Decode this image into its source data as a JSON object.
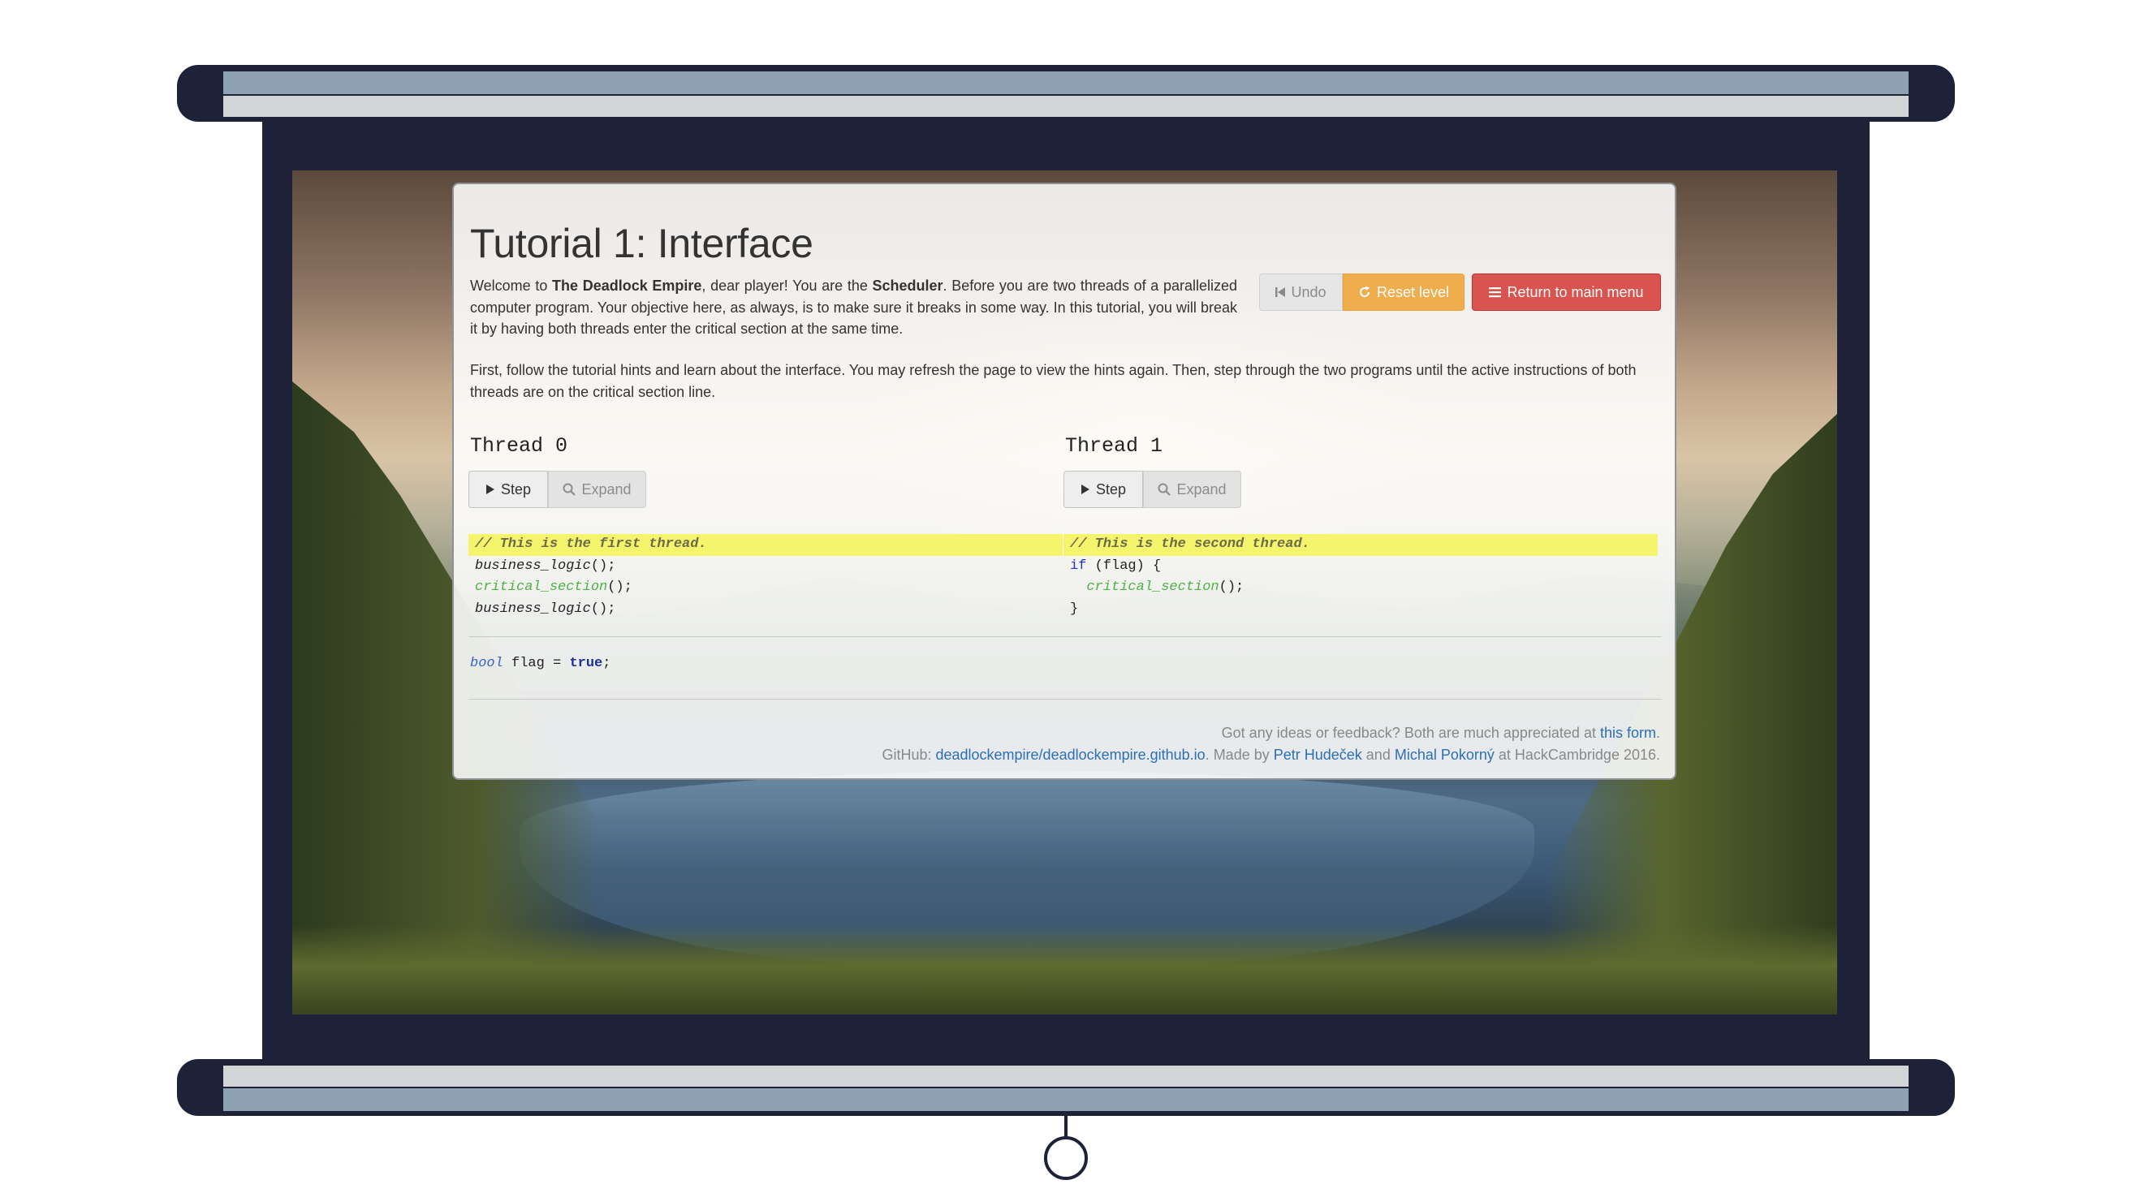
{
  "page": {
    "title": "Tutorial 1: Interface",
    "intro": {
      "p1": "Welcome to ",
      "b1": "The Deadlock Empire",
      "p2": ", dear player! You are the ",
      "b2": "Scheduler",
      "p3": ". Before you are two threads of a parallelized computer program. Your objective here, as always, is to make sure it breaks in some way. In this tutorial, you will break it by having both threads enter the critical section at the same time."
    },
    "instructions": "First, follow the tutorial hints and learn about the interface. You may refresh the page to view the hints again. Then, step through the two programs until the active instructions of both threads are on the critical section line."
  },
  "toolbar": {
    "undo_label": "Undo",
    "reset_label": "Reset level",
    "menu_label": "Return to main menu"
  },
  "threads": [
    {
      "title": "Thread 0",
      "step_label": "Step",
      "expand_label": "Expand",
      "lines": {
        "l0": "// This is the first thread.",
        "l1_fn": "business_logic",
        "l1_rest": "();",
        "l2_fn": "critical_section",
        "l2_rest": "();",
        "l3_fn": "business_logic",
        "l3_rest": "();"
      }
    },
    {
      "title": "Thread 1",
      "step_label": "Step",
      "expand_label": "Expand",
      "lines": {
        "l0": "// This is the second thread.",
        "l1_kw": "if",
        "l1_rest": " (flag) {",
        "l2_indent": "  ",
        "l2_fn": "critical_section",
        "l2_rest": "();",
        "l3": "}"
      }
    }
  ],
  "globals": {
    "type": "bool",
    "name": " flag = ",
    "value": "true",
    "end": ";"
  },
  "footer": {
    "feedback_text": "Got any ideas or feedback? Both are much appreciated at ",
    "feedback_link": "this form",
    "feedback_end": ".",
    "github_prefix": "GitHub: ",
    "github_link": "deadlockempire/deadlockempire.github.io",
    "made_by": ". Made by ",
    "author1": "Petr Hudeček",
    "and": " and ",
    "author2": "Michal Pokorný",
    "at": " at HackCambridge 2016."
  },
  "colors": {
    "frame": "#1d2238",
    "reset": "#f0ad4e",
    "menu": "#d9534f",
    "active_line": "#f4f56c",
    "critical": "#4db143",
    "link": "#2c6fb5"
  },
  "icons": {
    "undo": "step-backward-icon",
    "reset": "refresh-icon",
    "menu": "list-icon",
    "step": "play-icon",
    "expand": "search-icon"
  }
}
